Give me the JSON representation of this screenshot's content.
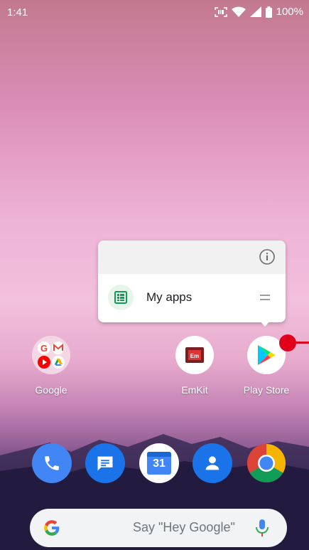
{
  "status_bar": {
    "time": "1:41",
    "battery": "100%"
  },
  "popup": {
    "item_label": "My apps"
  },
  "apps": [
    {
      "label": "Google"
    },
    {
      "label": "EmKit"
    },
    {
      "label": "Play Store"
    }
  ],
  "calendar_day": "31",
  "search": {
    "placeholder": "Say \"Hey Google\""
  }
}
